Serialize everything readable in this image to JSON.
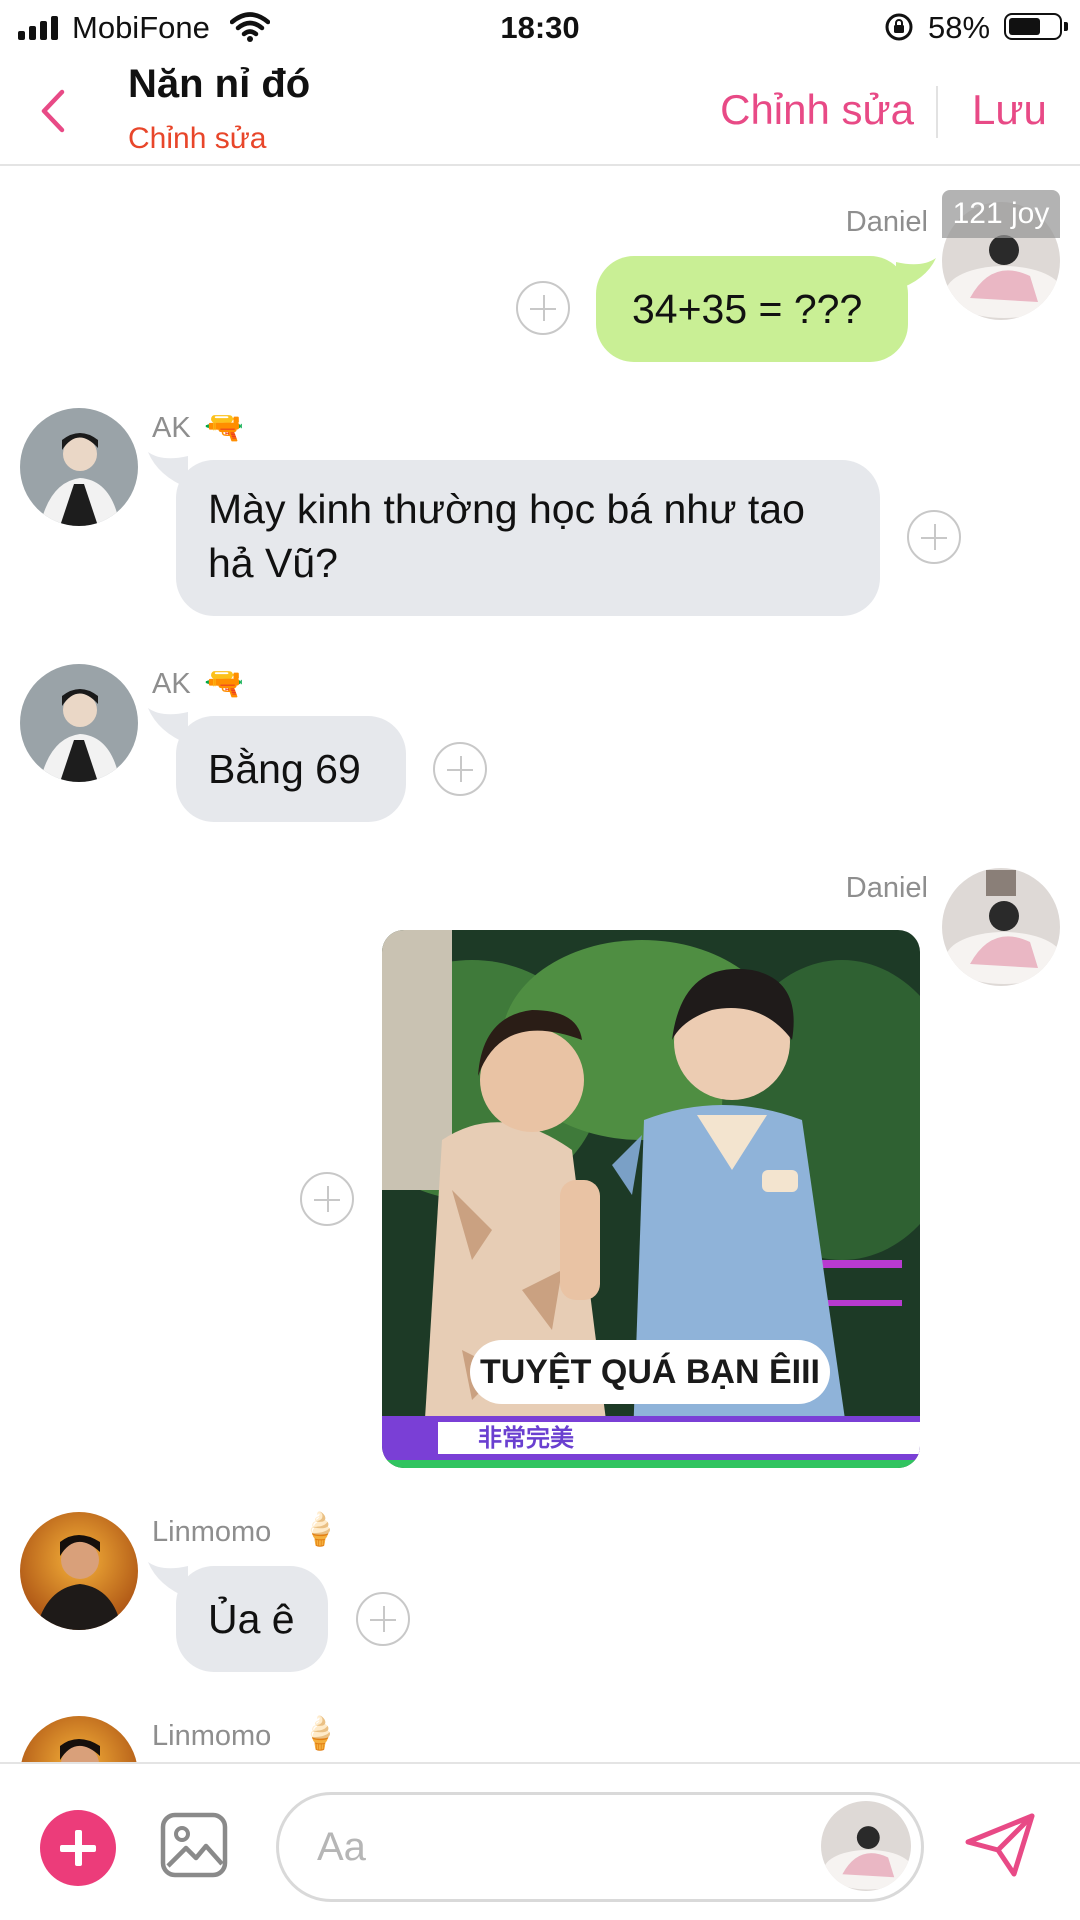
{
  "status": {
    "carrier": "MobiFone",
    "time": "18:30",
    "battery": "58%"
  },
  "header": {
    "title": "Năn nỉ đó",
    "subtitle": "Chỉnh sửa",
    "edit": "Chỉnh sửa",
    "save": "Lưu"
  },
  "messages": [
    {
      "sender": "Daniel",
      "text": "34+35 = ???",
      "badge": "121 joy"
    },
    {
      "sender": "AK",
      "emoji": "🔫",
      "text_line1": "Mày kinh thường học bá như tao",
      "text_line2": "hả Vũ?"
    },
    {
      "sender": "AK",
      "emoji": "🔫",
      "text": "Bằng 69"
    },
    {
      "sender": "Daniel",
      "image_caption": "TUYỆT QUÁ BẠN ÊIII",
      "image_ticker": "非常完美"
    },
    {
      "sender": "Linmomo",
      "emoji": "🍦",
      "text": "Ủa ê"
    },
    {
      "sender": "Linmomo",
      "emoji": "🍦"
    }
  ],
  "composer": {
    "placeholder": "Aa"
  }
}
